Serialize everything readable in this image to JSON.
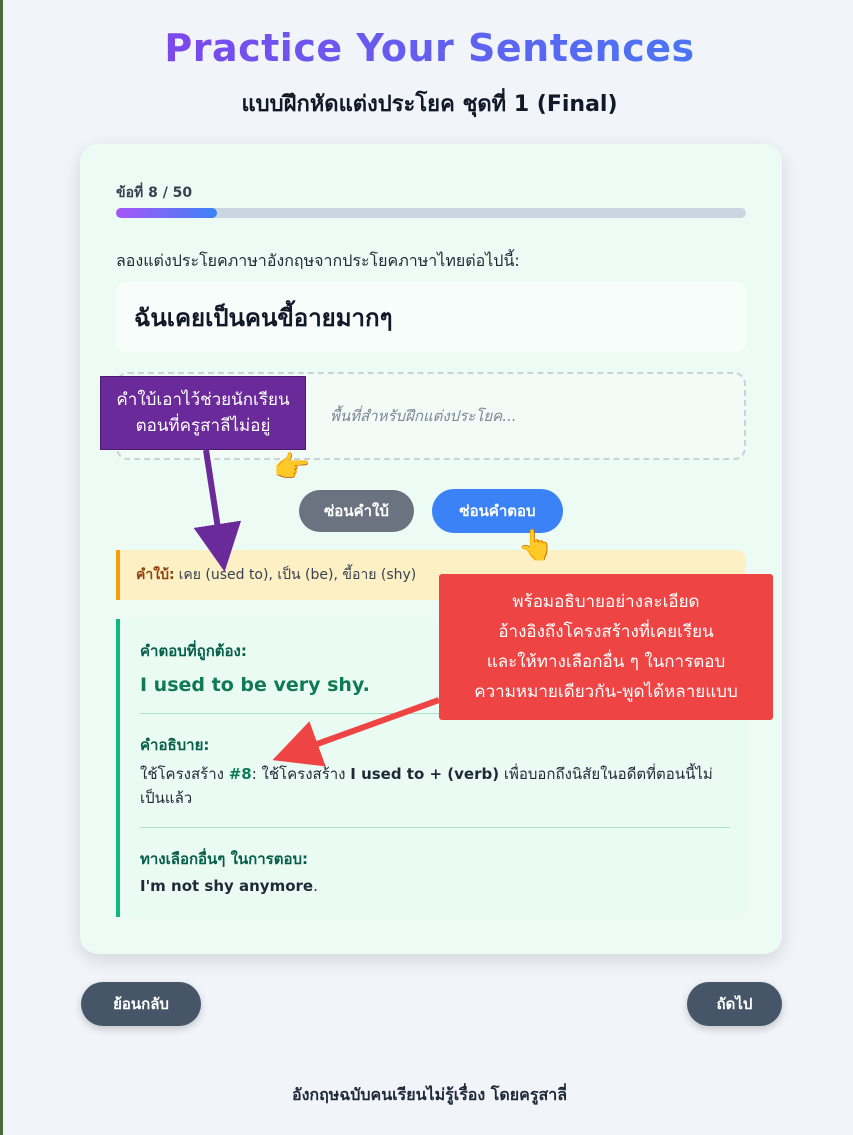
{
  "header": {
    "title": "Practice Your Sentences",
    "subtitle": "แบบฝึกหัดแต่งประโยค ชุดที่ 1 (Final)"
  },
  "progress": {
    "label": "ข้อที่ 8 / 50",
    "current": 8,
    "total": 50
  },
  "question": {
    "instruction": "ลองแต่งประโยคภาษาอังกฤษจากประโยคภาษาไทยต่อไปนี้:",
    "thai_sentence": "ฉันเคยเป็นคนขี้อายมากๆ",
    "answer_placeholder": "พื้นที่สำหรับฝึกแต่งประโยค..."
  },
  "buttons": {
    "hide_hint": "ซ่อนคำใบ้",
    "hide_answer": "ซ่อนคำตอบ"
  },
  "hint": {
    "key": "คำใบ้:",
    "text": "เคย (used to), เป็น (be), ขี้อาย (shy)"
  },
  "solution": {
    "correct_heading": "คำตอบที่ถูกต้อง:",
    "correct_answer": "I used to be very shy.",
    "explain_heading": "คำอธิบาย:",
    "explain_prefix": "ใช้โครงสร้าง ",
    "explain_ref": "#8",
    "explain_mid": ": ใช้โครงสร้าง ",
    "explain_bold": "I used to + (verb)",
    "explain_suffix": " เพื่อบอกถึงนิสัยในอดีตที่ตอนนี้ไม่เป็นแล้ว",
    "alt_heading": "ทางเลือกอื่นๆ ในการตอบ:",
    "alt_bold": "I'm not shy anymore",
    "alt_suffix": "."
  },
  "annotations": {
    "purple_line1": "คำใบ้เอาไว้ช่วยนักเรียน",
    "purple_line2": "ตอนที่ครูสาลีไม่อยู่",
    "red_line1": "พร้อมอธิบายอย่างละเอียด",
    "red_line2": "อ้างอิงถึงโครงสร้างที่เคยเรียน",
    "red_line3": "และให้ทางเลือกอื่น ๆ ในการตอบ",
    "red_line4": "ความหมายเดียวกัน-พูดได้หลายแบบ"
  },
  "nav": {
    "prev": "ย้อนกลับ",
    "next": "ถัดไป"
  },
  "footer": "อังกฤษฉบับคนเรียนไม่รู้เรื่อง โดยครูสาลี่",
  "colors": {
    "accent": "#3b82f6",
    "success": "#10b981",
    "warning": "#f59e0b",
    "annotation_red": "#ef4444",
    "annotation_purple": "#6b2a9a"
  }
}
